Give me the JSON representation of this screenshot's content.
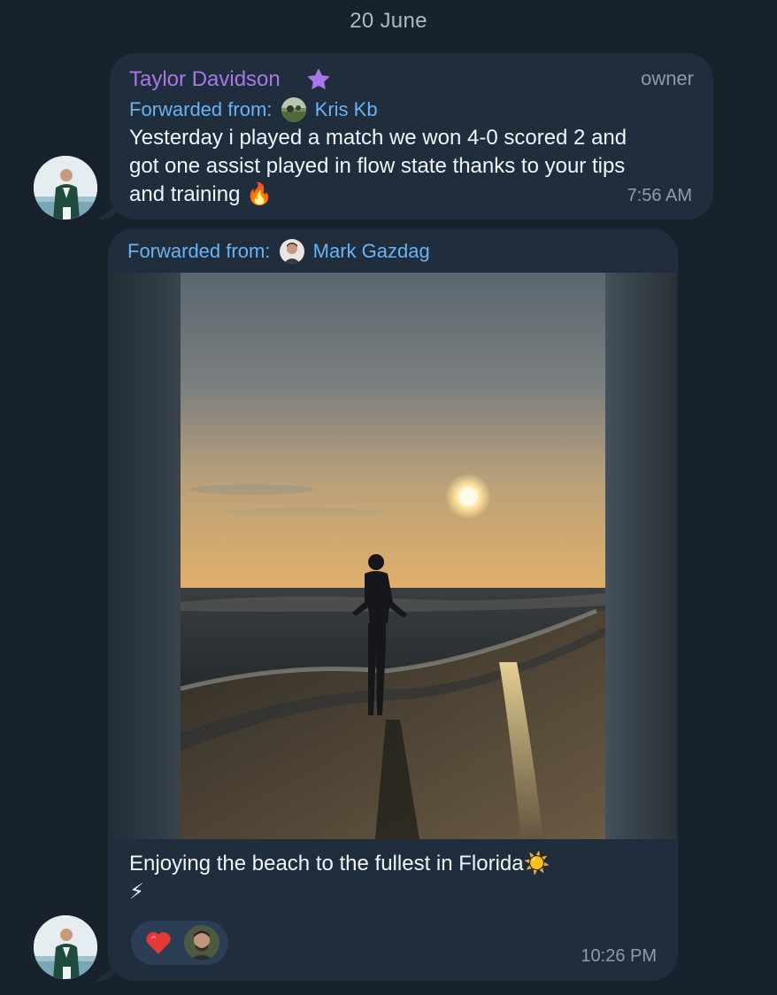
{
  "date_divider": "20 June",
  "messages": [
    {
      "sender": "Taylor Davidson",
      "role": "owner",
      "forwarded_label": "Forwarded from:",
      "forwarded_name": "Kris Kb",
      "text_lines": [
        "Yesterday i played a match we won 4-0 scored 2 and",
        "got one assist played in flow state thanks to your tips",
        "and training 🔥"
      ],
      "time": "7:56 AM"
    },
    {
      "forwarded_label": "Forwarded from:",
      "forwarded_name": "Mark Gazdag",
      "caption_lines": [
        "Enjoying the beach to the fullest in Florida☀️",
        "⚡"
      ],
      "reaction": "heart",
      "time": "10:26 PM"
    }
  ],
  "icons": {
    "badge": "star-icon",
    "reaction": "heart-icon"
  },
  "colors": {
    "background": "#18222d",
    "bubble": "#1f2d3d",
    "sender_name": "#a878e6",
    "link_blue": "#6ab3f3",
    "reaction_red": "#e53935"
  }
}
